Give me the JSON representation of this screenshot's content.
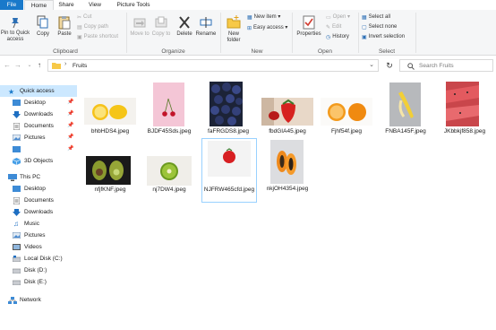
{
  "ribbon": {
    "tabs": [
      "File",
      "Home",
      "Share",
      "View",
      "Picture Tools"
    ],
    "clipboard": {
      "pin_label": "Pin to Quick access",
      "copy_label": "Copy",
      "paste_label": "Paste",
      "cut_label": "Cut",
      "copy_path_label": "Copy path",
      "paste_shortcut_label": "Paste shortcut",
      "group_label": "Clipboard"
    },
    "organize": {
      "move_to_label": "Move to",
      "copy_to_label": "Copy to",
      "delete_label": "Delete",
      "rename_label": "Rename",
      "group_label": "Organize"
    },
    "new": {
      "new_folder_label": "New folder",
      "new_item_label": "New item",
      "easy_access_label": "Easy access",
      "group_label": "New"
    },
    "open": {
      "properties_label": "Properties",
      "open_label": "Open",
      "edit_label": "Edit",
      "history_label": "History",
      "group_label": "Open"
    },
    "select": {
      "select_all_label": "Select all",
      "select_none_label": "Select none",
      "invert_label": "Invert selection",
      "group_label": "Select"
    }
  },
  "address": {
    "path": "Fruits",
    "search_placeholder": "Search Fruits"
  },
  "nav": {
    "quick_access": "Quick access",
    "qa_items": [
      "Desktop",
      "Downloads",
      "Documents",
      "Pictures",
      "3D Objects"
    ],
    "this_pc": "This PC",
    "pc_items": [
      "Desktop",
      "Documents",
      "Downloads",
      "Music",
      "Pictures",
      "Videos",
      "Local Disk (C:)",
      "Disk (D:)",
      "Disk (E:)"
    ],
    "network": "Network"
  },
  "files": [
    "bhbHDS4.jpeg",
    "BJDF45Sds.jpeg",
    "faFRGDS8.jpeg",
    "fbdGIA45.jpeg",
    "Fjhf54f.jpeg",
    "FNBA145F.jpeg",
    "JKbbkjf858.jpeg",
    "nfjfKNF.jpeg",
    "nj7DW4.jpeg",
    "NJFRW465cfd.jpeg",
    "nkjOH4354.jpeg"
  ],
  "colors": {
    "accent": "#1979ca",
    "selection": "#cce8ff",
    "selection_border": "#99d1ff"
  }
}
